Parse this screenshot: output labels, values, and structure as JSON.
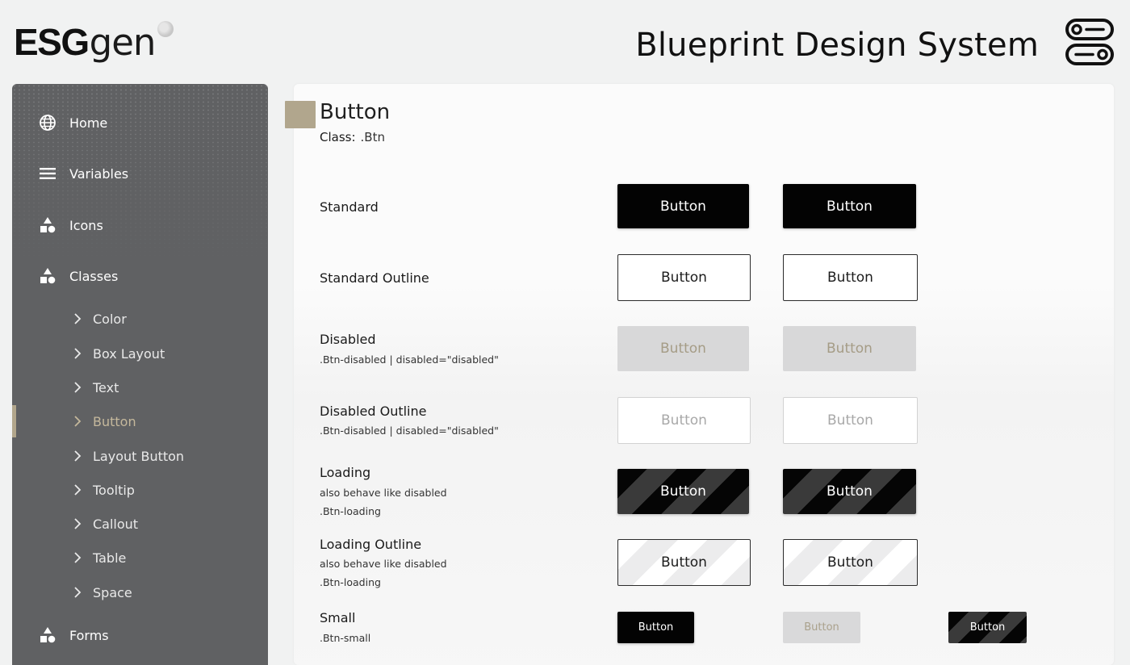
{
  "header": {
    "logo_bold": "ESG",
    "logo_light": "gen",
    "title": "Blueprint Design System"
  },
  "sidebar": {
    "items": [
      {
        "label": "Home",
        "icon": "globe-icon"
      },
      {
        "label": "Variables",
        "icon": "menu-icon"
      },
      {
        "label": "Icons",
        "icon": "shapes-icon"
      },
      {
        "label": "Classes",
        "icon": "shapes-icon"
      }
    ],
    "sub_items": [
      {
        "label": "Color"
      },
      {
        "label": "Box Layout"
      },
      {
        "label": "Text"
      },
      {
        "label": "Button",
        "active": true
      },
      {
        "label": "Layout Button"
      },
      {
        "label": "Tooltip"
      },
      {
        "label": "Callout"
      },
      {
        "label": "Table"
      },
      {
        "label": "Space"
      }
    ],
    "forms": {
      "label": "Forms",
      "icon": "shapes-icon"
    }
  },
  "main": {
    "title": "Button",
    "class_key": "Class:",
    "class_value": ".Btn",
    "button_label": "Button",
    "rows": [
      {
        "label": "Standard"
      },
      {
        "label": "Standard Outline"
      },
      {
        "label": "Disabled",
        "sub": ".Btn-disabled | disabled=\"disabled\""
      },
      {
        "label": "Disabled Outline",
        "sub": ".Btn-disabled | disabled=\"disabled\""
      },
      {
        "label": "Loading",
        "sub1": "also behave like disabled",
        "sub2": ".Btn-loading"
      },
      {
        "label": "Loading Outline",
        "sub1": "also behave like disabled",
        "sub2": ".Btn-loading"
      },
      {
        "label": "Small",
        "sub": ".Btn-small"
      }
    ]
  },
  "colors": {
    "sidebar_bg": "#606163",
    "accent": "#b1a68d",
    "button_dark": "#030303",
    "page_bg": "#f1f2f2"
  }
}
